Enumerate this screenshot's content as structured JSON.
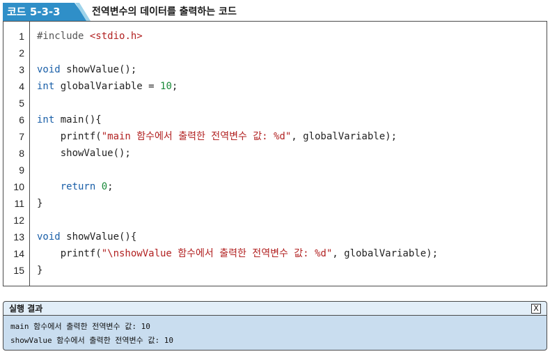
{
  "header": {
    "tag": "코드 5-3-3",
    "title": "전역변수의 데이터를 출력하는 코드"
  },
  "code": {
    "lines": [
      {
        "n": "1",
        "text": "#include <stdio.h>"
      },
      {
        "n": "2",
        "text": ""
      },
      {
        "n": "3",
        "text": "void showValue();"
      },
      {
        "n": "4",
        "text": "int globalVariable = 10;"
      },
      {
        "n": "5",
        "text": ""
      },
      {
        "n": "6",
        "text": "int main(){"
      },
      {
        "n": "7",
        "text": "    printf(\"main 함수에서 출력한 전역변수 값: %d\", globalVariable);"
      },
      {
        "n": "8",
        "text": "    showValue();"
      },
      {
        "n": "9",
        "text": ""
      },
      {
        "n": "10",
        "text": "    return 0;"
      },
      {
        "n": "11",
        "text": "}"
      },
      {
        "n": "12",
        "text": ""
      },
      {
        "n": "13",
        "text": "void showValue(){"
      },
      {
        "n": "14",
        "text": "    printf(\"\\nshowValue 함수에서 출력한 전역변수 값: %d\", globalVariable);"
      },
      {
        "n": "15",
        "text": "}"
      }
    ]
  },
  "result": {
    "title": "실행 결과",
    "close_label": "X",
    "lines": [
      "main 함수에서 출력한 전역변수 값: 10",
      "showValue 함수에서 출력한 전역변수 값: 10"
    ]
  },
  "colors": {
    "tag_bg": "#2f8fc8",
    "keyword": "#1a5fa8",
    "string": "#b22222",
    "number": "#1a8a3a",
    "result_bg": "#c9ddef"
  }
}
